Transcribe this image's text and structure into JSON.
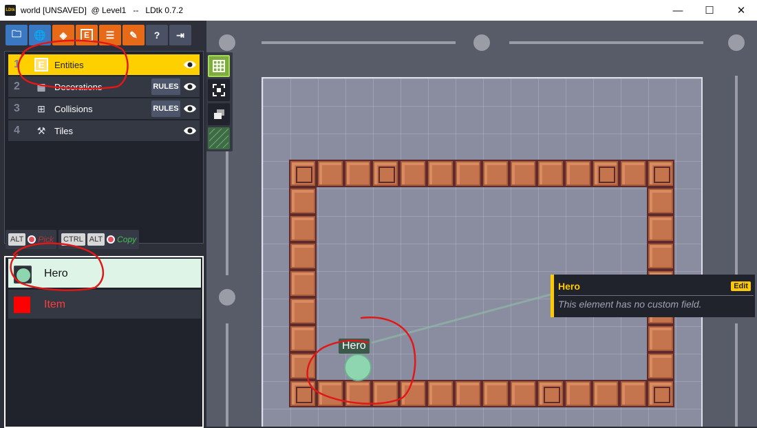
{
  "window": {
    "app_icon_text": "LDtk",
    "title": "world [UNSAVED]  @ Level1   --   LDtk 0.7.2",
    "minimize": "—",
    "maximize": "☐",
    "close": "✕"
  },
  "toolbar": [
    {
      "name": "project-settings-icon",
      "glyph": "🗀",
      "color": "blue"
    },
    {
      "name": "world-icon",
      "glyph": "🌐",
      "color": "blue"
    },
    {
      "name": "layers-icon",
      "glyph": "◈",
      "color": "orange"
    },
    {
      "name": "entities-icon",
      "glyph": "E",
      "color": "orange"
    },
    {
      "name": "enums-icon",
      "glyph": "☰",
      "color": "orange"
    },
    {
      "name": "tilesets-icon",
      "glyph": "✎",
      "color": "orange"
    },
    {
      "name": "help-icon",
      "glyph": "?",
      "color": "gray"
    },
    {
      "name": "exit-icon",
      "glyph": "⇥",
      "color": "gray"
    }
  ],
  "layers": [
    {
      "num": "1",
      "icon": "E",
      "label": "Entities",
      "rules": "",
      "active": true
    },
    {
      "num": "2",
      "icon": "▦",
      "label": "Decorations",
      "rules": "RULES",
      "active": false
    },
    {
      "num": "3",
      "icon": "⊞",
      "label": "Collisions",
      "rules": "RULES",
      "active": false
    },
    {
      "num": "4",
      "icon": "⚒",
      "label": "Tiles",
      "rules": "",
      "active": false
    }
  ],
  "shortcuts": {
    "pick_key": "ALT",
    "pick_label": "Pick",
    "copy_key1": "CTRL",
    "copy_key2": "ALT",
    "copy_label": "Copy"
  },
  "entities": [
    {
      "label": "Hero",
      "color": "#8ed6b0",
      "selected": true
    },
    {
      "label": "Item",
      "color": "#ff0000",
      "selected": false
    }
  ],
  "canvas": {
    "hero_label": "Hero",
    "popup": {
      "title": "Hero",
      "edit": "Edit",
      "message": "This element has no custom field."
    }
  },
  "colors": {
    "accent_yellow": "#ffd000",
    "hero_green": "#8ed6b0",
    "item_red": "#ff0000",
    "annotation_red": "#e01818"
  }
}
